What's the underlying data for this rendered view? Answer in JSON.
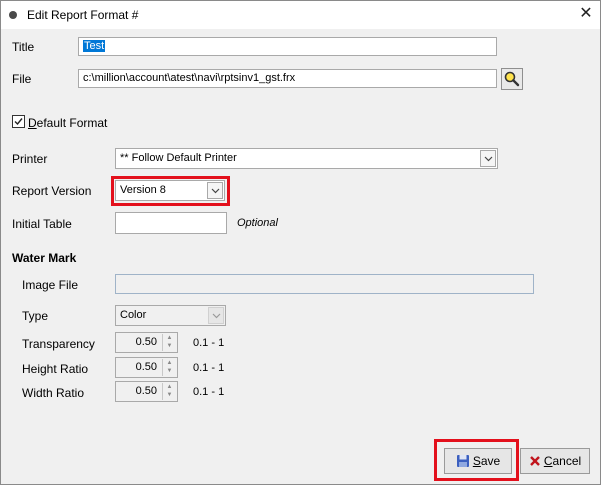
{
  "window": {
    "title": "Edit Report Format #"
  },
  "fields": {
    "title_label": "Title",
    "title_value": "Test",
    "file_label": "File",
    "file_value": "c:\\million\\account\\atest\\navi\\rptsinv1_gst.frx",
    "default_format_first": "D",
    "default_format_rest": "efault Format",
    "default_format_checked": true,
    "printer_label": "Printer",
    "printer_value": "** Follow Default Printer",
    "report_version_label": "Report Version",
    "report_version_value": "Version 8",
    "initial_table_label": "Initial Table",
    "initial_table_value": "",
    "optional_text": "Optional"
  },
  "watermark": {
    "heading": "Water Mark",
    "image_file_label": "Image File",
    "image_file_value": "",
    "type_label": "Type",
    "type_value": "Color",
    "transparency_label": "Transparency",
    "transparency_value": "0.50",
    "transparency_range": "0.1 - 1",
    "height_ratio_label": "Height Ratio",
    "height_ratio_value": "0.50",
    "height_ratio_range": "0.1 - 1",
    "width_ratio_label": "Width Ratio",
    "width_ratio_value": "0.50",
    "width_ratio_range": "0.1 - 1"
  },
  "buttons": {
    "save_first": "S",
    "save_rest": "ave",
    "cancel_first": "C",
    "cancel_rest": "ancel"
  },
  "icons": {
    "app": "app-dot-icon",
    "close": "close-icon",
    "browse": "magnifier-icon",
    "save": "floppy-disk-icon",
    "cancel": "red-x-icon"
  },
  "colors": {
    "highlight": "#e3101c",
    "selection": "#0078d7"
  }
}
